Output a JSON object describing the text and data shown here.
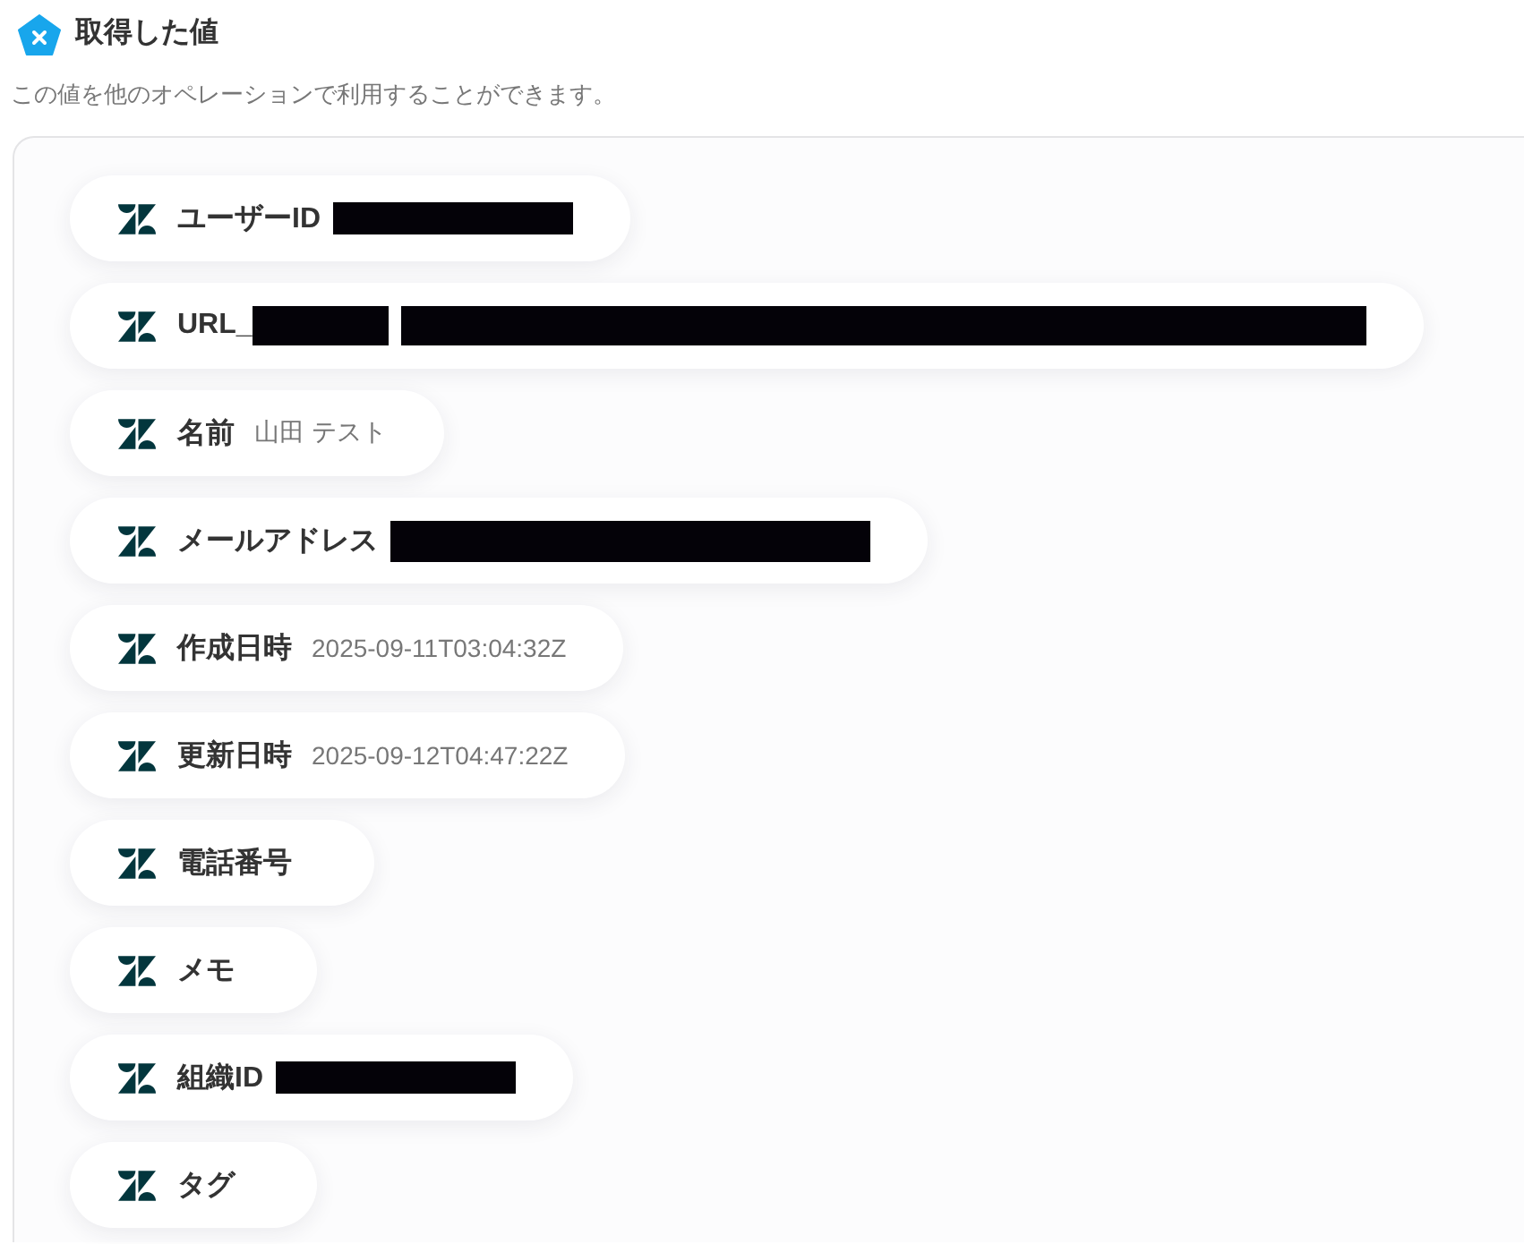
{
  "header": {
    "title": "取得した値",
    "description": "この値を他のオペレーションで利用することができます。"
  },
  "values": [
    {
      "kind": "id",
      "label": "ユーザーID",
      "label_redacted": false,
      "value_redacted": true
    },
    {
      "kind": "url",
      "label": "URL_",
      "label_redacted": true,
      "value_redacted": true
    },
    {
      "kind": "text",
      "label": "名前",
      "label_redacted": false,
      "value": "山田 テスト",
      "value_redacted": false
    },
    {
      "kind": "email",
      "label": "メールアドレス",
      "label_redacted": false,
      "value_redacted": true
    },
    {
      "kind": "text",
      "label": "作成日時",
      "label_redacted": false,
      "value": "2025-09-11T03:04:32Z",
      "value_redacted": false
    },
    {
      "kind": "text",
      "label": "更新日時",
      "label_redacted": false,
      "value": "2025-09-12T04:47:22Z",
      "value_redacted": false
    },
    {
      "kind": "text",
      "label": "電話番号",
      "label_redacted": false,
      "value_redacted": false
    },
    {
      "kind": "text",
      "label": "メモ",
      "label_redacted": false,
      "value_redacted": false
    },
    {
      "kind": "id",
      "label": "組織ID",
      "label_redacted": false,
      "value_redacted": true
    },
    {
      "kind": "text",
      "label": "タグ",
      "label_redacted": false,
      "value_redacted": false
    }
  ]
}
